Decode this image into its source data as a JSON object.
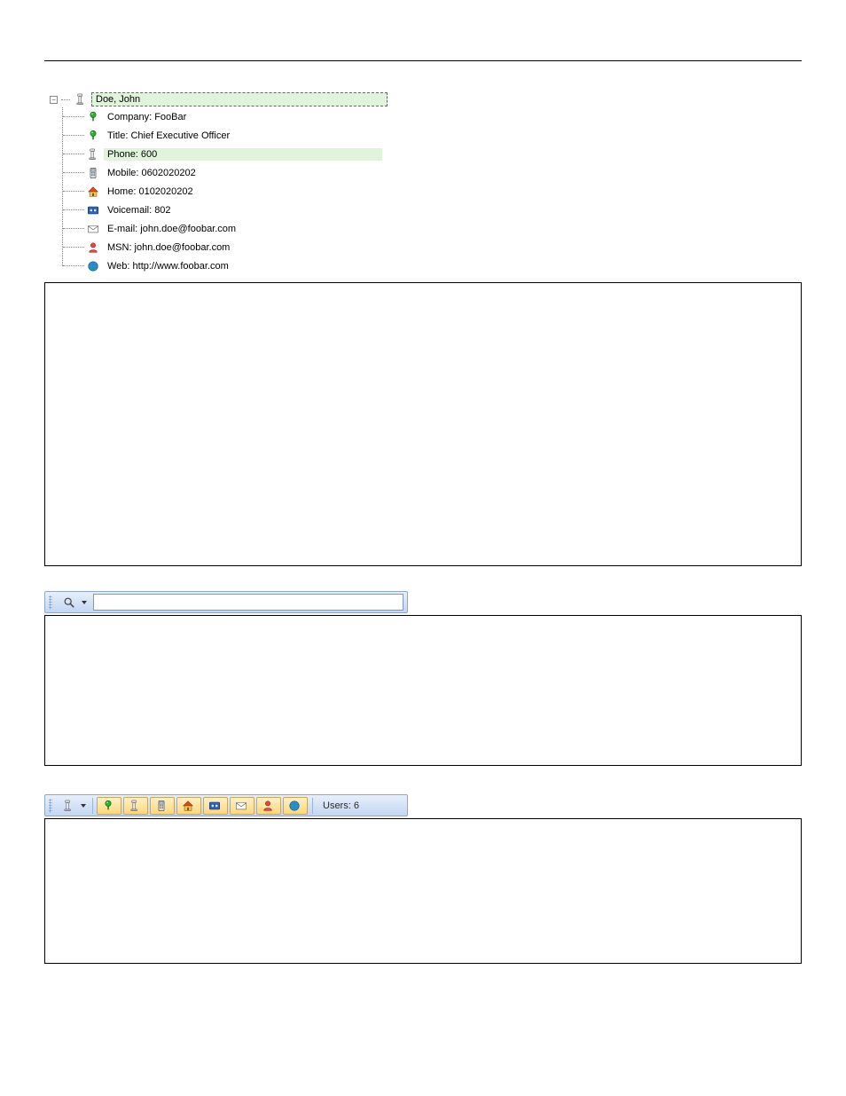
{
  "tree": {
    "root": {
      "name": "Doe, John"
    },
    "items": [
      {
        "key": "company",
        "icon": "pushpin-green",
        "label": "Company: FooBar",
        "highlight": false
      },
      {
        "key": "title",
        "icon": "pushpin-green",
        "label": "Title: Chief Executive Officer",
        "highlight": false
      },
      {
        "key": "phone",
        "icon": "phone",
        "label": "Phone: 600",
        "highlight": true
      },
      {
        "key": "mobile",
        "icon": "mobile-phone",
        "label": "Mobile: 0602020202",
        "highlight": false
      },
      {
        "key": "home",
        "icon": "house",
        "label": "Home: 0102020202",
        "highlight": false
      },
      {
        "key": "voicemail",
        "icon": "tape",
        "label": "Voicemail: 802",
        "highlight": false
      },
      {
        "key": "email",
        "icon": "envelope",
        "label": "E-mail: john.doe@foobar.com",
        "highlight": false
      },
      {
        "key": "msn",
        "icon": "person-red",
        "label": "MSN: john.doe@foobar.com",
        "highlight": false
      },
      {
        "key": "web",
        "icon": "globe",
        "label": "Web: http://www.foobar.com",
        "highlight": false
      }
    ]
  },
  "search": {
    "value": "",
    "placeholder": ""
  },
  "status": {
    "users_label": "Users: 6"
  },
  "toolbar_actions": [
    {
      "icon": "phone-dropdown",
      "name": "phone-actions-button",
      "has_caret": true,
      "active": false
    },
    {
      "icon": "pushpin-green",
      "name": "filter-company-button",
      "has_caret": false,
      "active": true
    },
    {
      "icon": "phone",
      "name": "filter-phone-button",
      "has_caret": false,
      "active": true
    },
    {
      "icon": "mobile-phone",
      "name": "filter-mobile-button",
      "has_caret": false,
      "active": true
    },
    {
      "icon": "house",
      "name": "filter-home-button",
      "has_caret": false,
      "active": true
    },
    {
      "icon": "tape",
      "name": "filter-voicemail-button",
      "has_caret": false,
      "active": true
    },
    {
      "icon": "envelope",
      "name": "filter-email-button",
      "has_caret": false,
      "active": true
    },
    {
      "icon": "person-red",
      "name": "filter-msn-button",
      "has_caret": false,
      "active": true
    },
    {
      "icon": "globe",
      "name": "filter-web-button",
      "has_caret": false,
      "active": true
    }
  ],
  "icons": {
    "phone": "phone-icon",
    "phone-dropdown": "phone-icon",
    "pushpin-green": "pushpin-icon",
    "mobile-phone": "mobile-phone-icon",
    "house": "house-icon",
    "tape": "tape-icon",
    "envelope": "envelope-icon",
    "person-red": "person-icon",
    "globe": "globe-icon",
    "magnifier": "magnifier-icon"
  }
}
